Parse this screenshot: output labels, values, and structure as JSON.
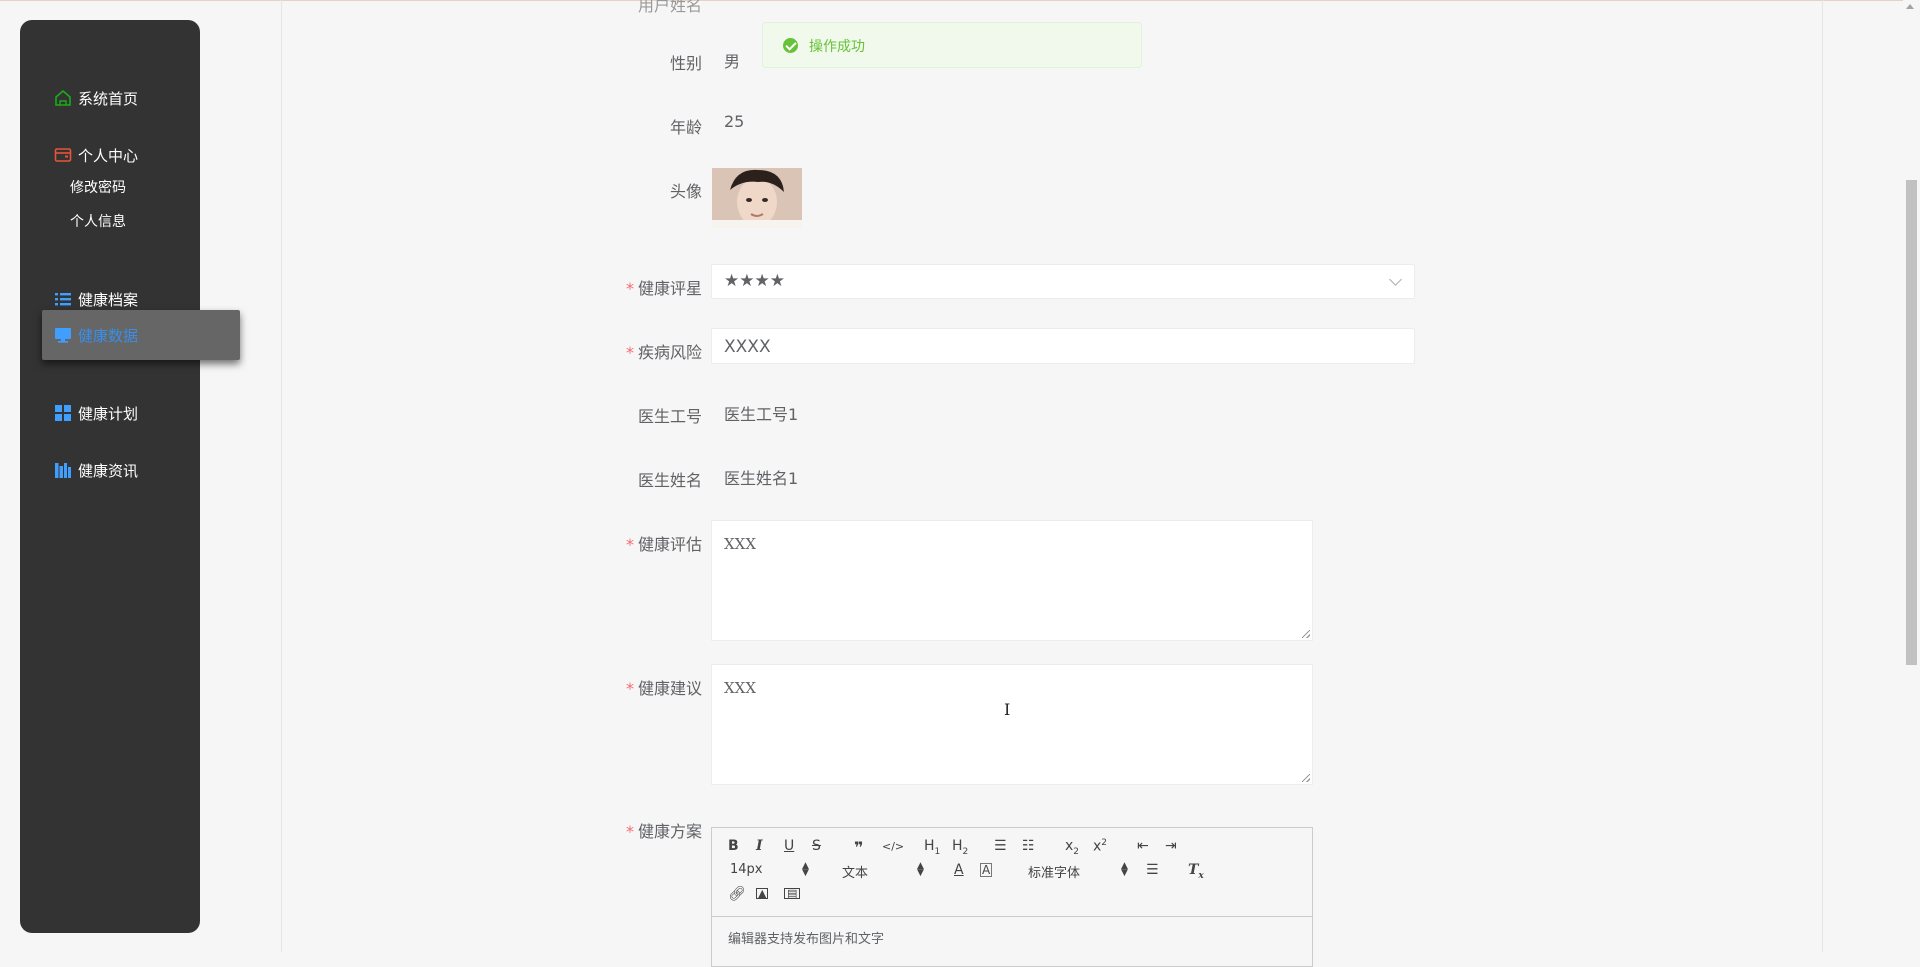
{
  "sidebar": {
    "items": [
      {
        "label": "系统首页",
        "icon": "home-icon",
        "color": "#1aad19"
      },
      {
        "label": "个人中心",
        "icon": "wallet-icon",
        "color": "#e8543a"
      },
      {
        "label": "健康档案",
        "icon": "list-icon",
        "color": "#409eff"
      },
      {
        "label": "健康数据",
        "icon": "monitor-icon",
        "color": "#409eff"
      },
      {
        "label": "健康计划",
        "icon": "grid-icon",
        "color": "#409eff"
      },
      {
        "label": "健康资讯",
        "icon": "books-icon",
        "color": "#409eff"
      }
    ],
    "sub_items": [
      "修改密码",
      "个人信息"
    ],
    "active": "健康数据"
  },
  "toast": {
    "message": "操作成功"
  },
  "form": {
    "gender": {
      "label": "性别",
      "value": "男"
    },
    "age": {
      "label": "年龄",
      "value": "25"
    },
    "avatar": {
      "label": "头像"
    },
    "rating": {
      "label": "健康评星",
      "value": "★★★★"
    },
    "disease_risk": {
      "label": "疾病风险",
      "value": "XXXX"
    },
    "doctor_id": {
      "label": "医生工号",
      "value": "医生工号1"
    },
    "doctor_name": {
      "label": "医生姓名",
      "value": "医生姓名1"
    },
    "assessment": {
      "label": "健康评估",
      "value": "XXX"
    },
    "advice": {
      "label": "健康建议",
      "value": "XXX"
    },
    "plan": {
      "label": "健康方案"
    }
  },
  "editor": {
    "font_size": "14px",
    "header": "文本",
    "font_family": "标准字体",
    "placeholder": "编辑器支持发布图片和文字"
  }
}
